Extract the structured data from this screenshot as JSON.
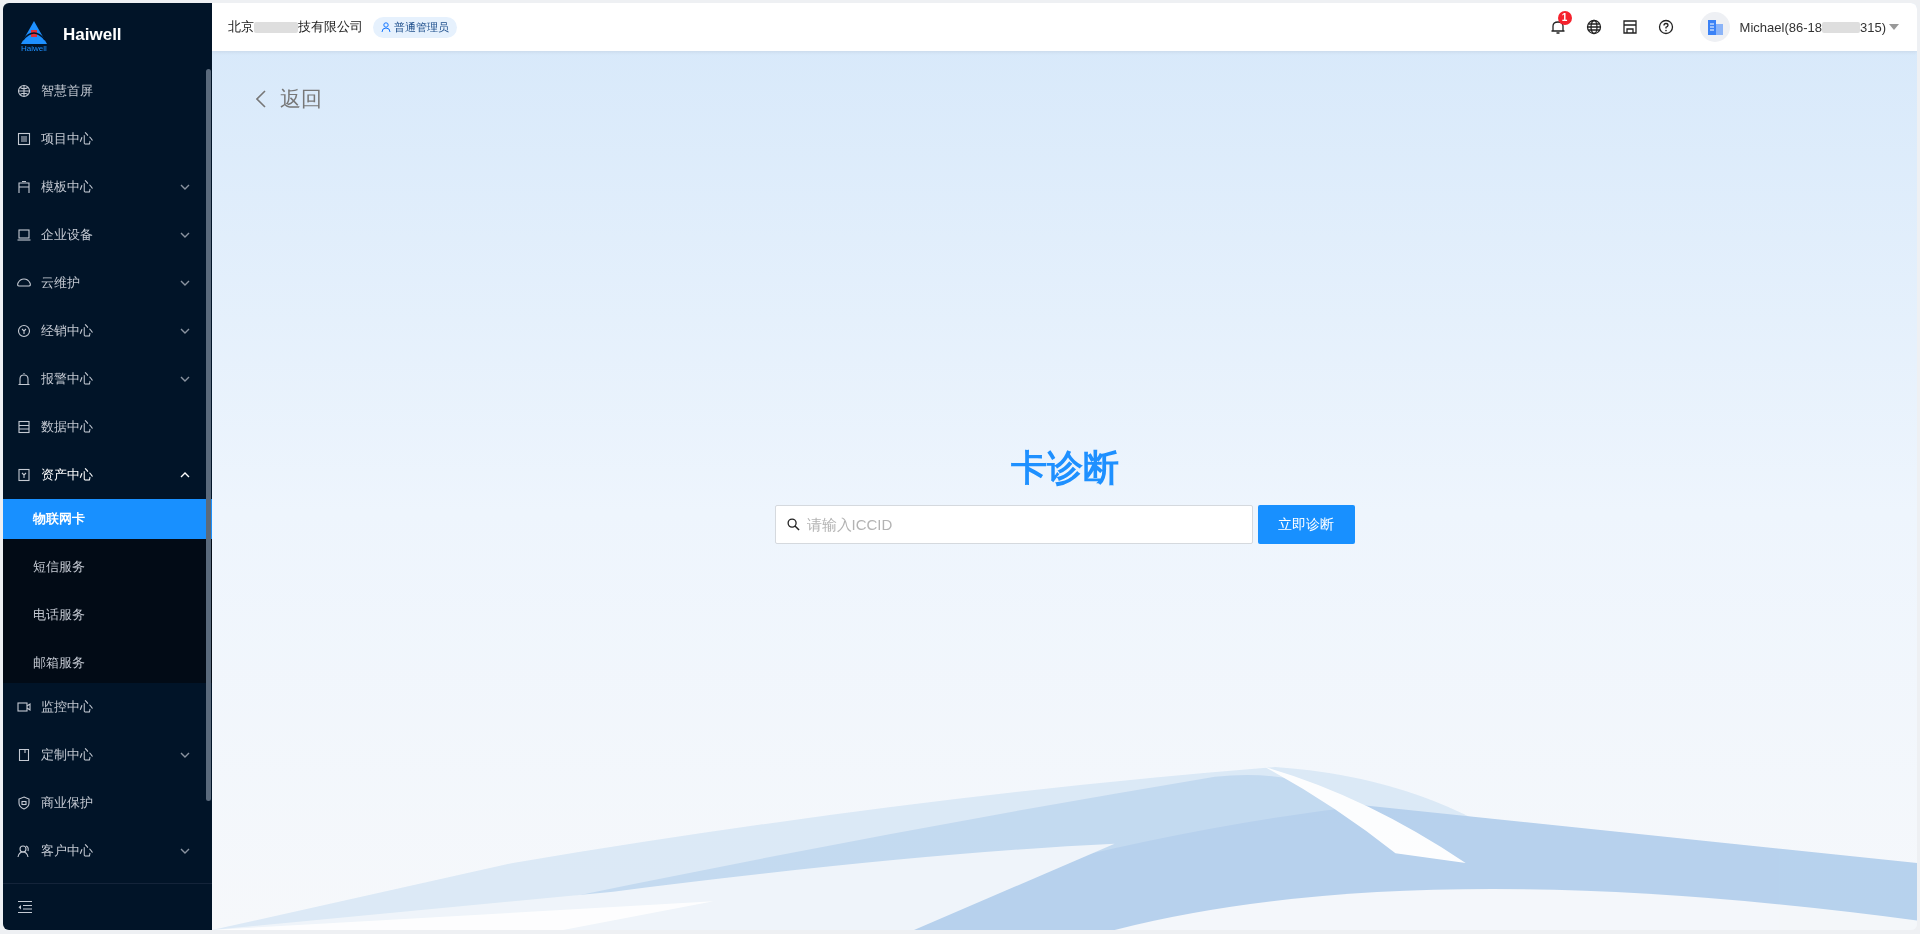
{
  "brand": {
    "name": "Haiwell",
    "logo_caption": "Haiwell"
  },
  "sidebar": {
    "items": [
      {
        "label": "智慧首屏",
        "kind": "link"
      },
      {
        "label": "项目中心",
        "kind": "link"
      },
      {
        "label": "模板中心",
        "kind": "group",
        "expanded": false
      },
      {
        "label": "企业设备",
        "kind": "group",
        "expanded": false
      },
      {
        "label": "云维护",
        "kind": "group",
        "expanded": false
      },
      {
        "label": "经销中心",
        "kind": "group",
        "expanded": false
      },
      {
        "label": "报警中心",
        "kind": "group",
        "expanded": false
      },
      {
        "label": "数据中心",
        "kind": "link"
      },
      {
        "label": "资产中心",
        "kind": "group",
        "expanded": true,
        "children": [
          {
            "label": "物联网卡",
            "selected": true
          },
          {
            "label": "短信服务",
            "selected": false
          },
          {
            "label": "电话服务",
            "selected": false
          },
          {
            "label": "邮箱服务",
            "selected": false
          }
        ]
      },
      {
        "label": "监控中心",
        "kind": "link"
      },
      {
        "label": "定制中心",
        "kind": "group",
        "expanded": false
      },
      {
        "label": "商业保护",
        "kind": "link"
      },
      {
        "label": "客户中心",
        "kind": "group",
        "expanded": false
      }
    ]
  },
  "header": {
    "company_start": "北京",
    "company_end": "技有限公司",
    "role": "普通管理员",
    "notification_count": "1",
    "user_start": "Michael(86-18",
    "user_end": "315)"
  },
  "page": {
    "back": "返回",
    "title": "卡诊断",
    "search": {
      "placeholder": "请输入ICCID"
    },
    "button": "立即诊断"
  }
}
